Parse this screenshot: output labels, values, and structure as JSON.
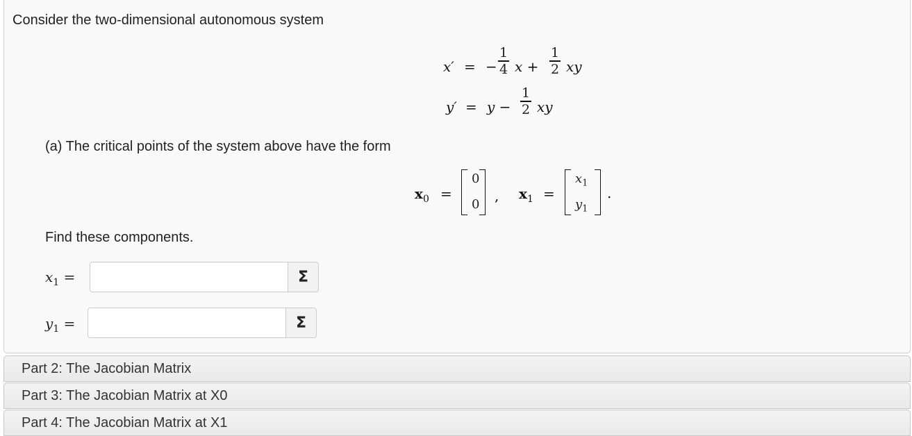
{
  "intro": "Consider the two-dimensional autonomous system",
  "equations": {
    "eq1_lhs": "x′",
    "eq1_eq": "=",
    "eq1_minus": "−",
    "eq1_frac1_num": "1",
    "eq1_frac1_den": "4",
    "eq1_term1": "x +",
    "eq1_frac2_num": "1",
    "eq1_frac2_den": "2",
    "eq1_term2": "xy",
    "eq2_lhs": "y′",
    "eq2_eq": "=",
    "eq2_term1": "y −",
    "eq2_frac_num": "1",
    "eq2_frac_den": "2",
    "eq2_term2": "xy"
  },
  "part_a": {
    "text": "(a) The critical points of the system above have the form",
    "x0_label": "x",
    "x0_sub": "0",
    "eq": "=",
    "x0_top": "0",
    "x0_bottom": "0",
    "comma": ",",
    "x1_label": "x",
    "x1_sub": "1",
    "x1_top_var": "x",
    "x1_top_sub": "1",
    "x1_bottom_var": "y",
    "x1_bottom_sub": "1",
    "period": "."
  },
  "find_text": "Find these components.",
  "inputs": [
    {
      "var": "x",
      "sub": "1",
      "eq": "=",
      "value": "",
      "button": "Σ"
    },
    {
      "var": "y",
      "sub": "1",
      "eq": "=",
      "value": "",
      "button": "Σ"
    }
  ],
  "parts": [
    {
      "label": "Part 2: The Jacobian Matrix"
    },
    {
      "label": "Part 3: The Jacobian Matrix at X0"
    },
    {
      "label": "Part 4: The Jacobian Matrix at X1"
    }
  ]
}
